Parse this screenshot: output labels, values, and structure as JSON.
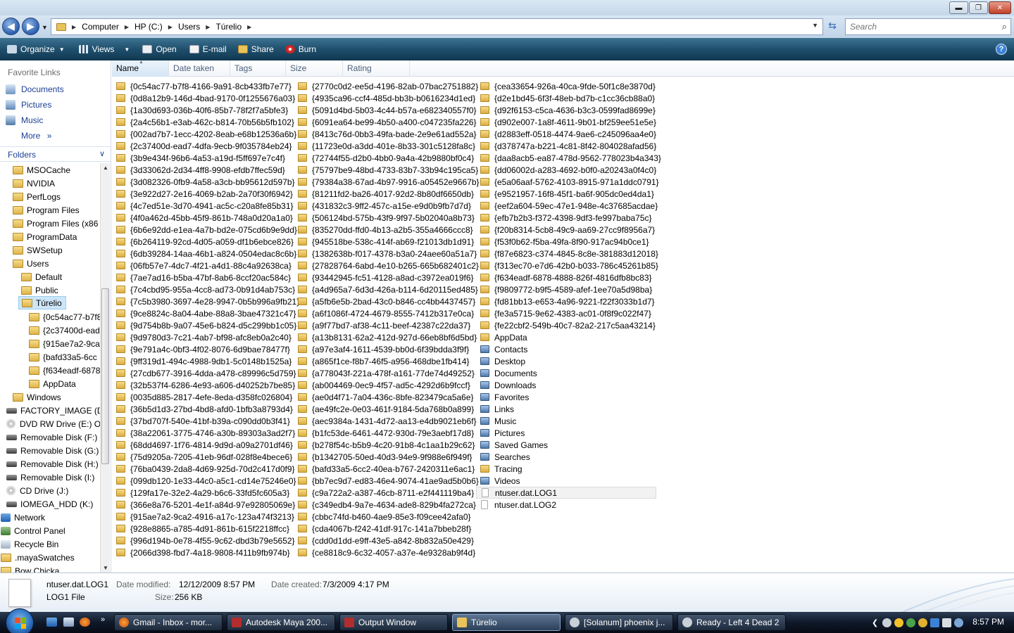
{
  "address": {
    "crumbs": [
      "Computer",
      "HP (C:)",
      "Users",
      "Túrelio"
    ],
    "search_placeholder": "Search"
  },
  "toolbar": {
    "organize": "Organize",
    "views": "Views",
    "open": "Open",
    "email": "E-mail",
    "share": "Share",
    "burn": "Burn"
  },
  "nav": {
    "favorite_links": "Favorite Links",
    "documents": "Documents",
    "pictures": "Pictures",
    "music": "Music",
    "more": "More",
    "folders": "Folders",
    "tree": [
      "MSOCache",
      "NVIDIA",
      "PerfLogs",
      "Program Files",
      "Program Files (x86",
      "ProgramData",
      "SWSetup",
      "Users",
      "Default",
      "Public",
      "Túrelio",
      "{0c54ac77-b7f8",
      "{2c37400d-ead",
      "{915ae7a2-9ca",
      "{bafd33a5-6cc",
      "{f634eadf-6878",
      "AppData",
      "Windows",
      "FACTORY_IMAGE (D",
      "DVD RW Drive (E:) O",
      "Removable Disk (F:)",
      "Removable Disk (G:)",
      "Removable Disk (H:)",
      "Removable Disk (I:)",
      "CD Drive (J:)",
      "IOMEGA_HDD (K:)",
      "Network",
      "Control Panel",
      "Recycle Bin",
      ".mayaSwatches",
      "Bow Chicka"
    ]
  },
  "columns": [
    "Name",
    "Date taken",
    "Tags",
    "Size",
    "Rating"
  ],
  "files": {
    "col1": [
      "{0c54ac77-b7f8-4166-9a91-8cb433fb7e77}",
      "{0d8a12b9-146d-4bad-9170-0f1255676a03}",
      "{1a30d693-036b-40f6-85b7-78f2f7a5bfe3}",
      "{2a4c56b1-e3ab-462c-b814-70b56b5fb102}",
      "{002ad7b7-1ecc-4202-8eab-e68b12536a6b}",
      "{2c37400d-ead7-4dfa-9ecb-9f035784eb24}",
      "{3b9e434f-96b6-4a53-a19d-f5ff697e7c4f}",
      "{3d33062d-2d34-4ff8-9908-efdb7ffec59d}",
      "{3d082326-0fb9-4a58-a3cb-bb95612d597b}",
      "{3e922d27-2e16-4069-b2ab-2a70f30f6942}",
      "{4c7ed51e-3d70-4941-ac5c-c20a8fe85b31}",
      "{4f0a462d-45bb-45f9-861b-748a0d20a1a0}",
      "{6b6e92dd-e1ea-4a7b-bd2e-075cd6b9e9dd}",
      "{6b264119-92cd-4d05-a059-df1b6ebce826}",
      "{6db39284-14aa-46b1-a824-0504edac8c6b}",
      "{06fb57e7-4dc7-4f21-a4d1-88c4a92638ca}",
      "{7ae7ad16-b5ba-47bf-8ab6-8ccf20ac584c}",
      "{7c4cbd95-955a-4cc8-ad73-0b91d4ab753c}",
      "{7c5b3980-3697-4e28-9947-0b5b996a9fb21}",
      "{9ce8824c-8a04-4abe-88a8-3bae47321c47}",
      "{9d754b8b-9a07-45e6-b824-d5c299bb1c05}",
      "{9d9780d3-7c21-4ab7-bf98-afc8eb0a2c40}",
      "{9e791a4c-0bf3-4f02-8076-6d9bae78477f}",
      "{9ff319d1-494c-4988-9db1-5c0148b1525a}",
      "{27cdb677-3916-4dda-a478-c89996c5d759}",
      "{32b537f4-6286-4e93-a606-d40252b7be85}",
      "{0035d885-2817-4efe-8eda-d358fc026804}",
      "{36b5d1d3-27bd-4bd8-afd0-1bfb3a8793d4}",
      "{37bd707f-540e-41bf-b39a-c090dd0b3f41}",
      "{38a22061-3775-4746-a30b-89303a3ad2f7}",
      "{68dd4697-1f76-4814-9d9d-a09a2701df46}",
      "{75d9205a-7205-41eb-96df-028f8e4bece6}",
      "{76ba0439-2da8-4d69-925d-70d2c417d0f9}",
      "{099db120-1e33-44c0-a5c1-cd14e75246e0}",
      "{129fa17e-32e2-4a29-b6c6-33fd5fc605a3}",
      "{366e8a76-5201-4e1f-a84d-97e92805069e}",
      "{915ae7a2-9ca2-4916-a17c-123a474f3213}",
      "{928e8865-a785-4d91-861b-615f2218ffcc}",
      "{996d194b-0e78-4f55-9c62-dbd3b79e5652}",
      "{2066d398-fbd7-4a18-9808-f411b9fb974b}"
    ],
    "col2": [
      "{2770c0d2-ee5d-4196-82ab-07bac2751882}",
      "{4935ca96-ccf4-485d-bb3b-b0616234d1ed}",
      "{5091d4bd-5b03-4c44-b57a-e682340557f0}",
      "{6091ea64-be99-4b50-a400-c047235fa226}",
      "{8413c76d-0bb3-49fa-bade-2e9e61ad552a}",
      "{11723e0d-a3dd-401e-8b33-301c5128fa8c}",
      "{72744f55-d2b0-4bb0-9a4a-42b9880bf0c4}",
      "{75797be9-48bd-4733-83b7-33b94c195ca5}",
      "{79384a38-67ad-4b97-9916-a05452e9667b}",
      "{81211fd2-ba26-4017-92d2-8b80df6650db}",
      "{431832c3-9ff2-457c-a15e-e9d0b9fb7d7d}",
      "{506124bd-575b-43f9-9f97-5b02040a8b73}",
      "{835270dd-ffd0-4b13-a2b5-355a4666ccc8}",
      "{945518be-538c-414f-ab69-f21013db1d91}",
      "{1382638b-f017-4378-b3a0-24aee60a51a7}",
      "{27828764-6abd-4e10-b265-665b682401c2}",
      "{93442945-fc51-4128-a8ad-c3972ea019f6}",
      "{a4d965a7-6d3d-426a-b114-6d20115ed485}",
      "{a5fb6e5b-2bad-43c0-b846-cc4bb4437457}",
      "{a6f1086f-4724-4679-8555-7412b317e0ca}",
      "{a9f77bd7-af38-4c11-beef-42387c22da37}",
      "{a13b8131-62a2-412d-927d-66eb8bf6d5bd}",
      "{a97e3af4-1611-4539-bb0d-6f39bdda3f9f}",
      "{a865f1ce-f8b7-46f5-a956-468dbe1fb414}",
      "{a778043f-221a-478f-a161-77de74d49252}",
      "{ab004469-0ec9-4f57-ad5c-4292d6b9fccf}",
      "{ae0d4f71-7a04-436c-8bfe-823479ca5a6e}",
      "{ae49fc2e-0e03-461f-9184-5da768b0a899}",
      "{aec9384a-1431-4d72-aa13-e4db9021eb6f}",
      "{b1fc53de-6461-4472-930d-79e3aebf17d8}",
      "{b278f54c-b5b9-4c20-91b8-4c1aa1b29c62}",
      "{b1342705-50ed-40d3-94e9-9f988e6f949f}",
      "{bafd33a5-6cc2-40ea-b767-2420311e6ac1}",
      "{bb7ec9d7-ed83-46e4-9074-41ae9ad5b0b6}",
      "{c9a722a2-a387-46cb-8711-e2f441119ba4}",
      "{c349edb4-9a7e-4634-ade8-829b4fa272ca}",
      "{cbbc74fd-b460-4ae9-85e3-f09cee42afa0}",
      "{cda4067b-f242-41df-917c-141a7bbeb28f}",
      "{cdd0d1dd-e9ff-43e5-a842-8b832a50e429}",
      "{ce8818c9-6c32-4057-a37e-4e9328ab9f4d}"
    ],
    "col3": [
      "{cea33654-926a-40ca-9fde-50f1c8e3870d}",
      "{d2e1bd45-6f3f-48eb-bd7b-c1cc36cb88a0}",
      "{d92f6153-c5ca-4636-b3c3-0599fad8699e}",
      "{d902e007-1a8f-4611-9b01-bf259ee51e5e}",
      "{d2883eff-0518-4474-9ae6-c245096aa4e0}",
      "{d378747a-b221-4c81-8f42-804028afad56}",
      "{daa8acb5-ea87-478d-9562-778023b4a343}",
      "{dd06002d-a283-4692-b0f0-a20243a0f4c0}",
      "{e5a06aaf-5762-4103-8915-971a1ddc0791}",
      "{e9521957-16f8-45f1-ba6f-905dc0ed4da1}",
      "{eef2a604-59ec-47e1-948e-4c37685acdae}",
      "{efb7b2b3-f372-4398-9df3-fe997baba75c}",
      "{f20b8314-5cb8-49c9-aa69-27cc9f8956a7}",
      "{f53f0b62-f5ba-49fa-8f90-917ac94b0ce1}",
      "{f87e6823-c374-4845-8c8e-381883d12018}",
      "{f313ec70-e7d6-42b0-b033-786c45261b85}",
      "{f634eadf-6878-4888-826f-4816dfb8bc83}",
      "{f9809772-b9f5-4589-afef-1ee70a5d98ba}",
      "{fd81bb13-e653-4a96-9221-f22f3033b1d7}",
      "{fe3a5715-9e62-4383-ac01-0f8f9c022f47}",
      "{fe22cbf2-549b-40c7-82a2-217c5aa43214}",
      "AppData",
      "Contacts",
      "Desktop",
      "Documents",
      "Downloads",
      "Favorites",
      "Links",
      "Music",
      "Pictures",
      "Saved Games",
      "Searches",
      "Tracing",
      "Videos",
      "ntuser.dat.LOG1",
      "ntuser.dat.LOG2"
    ]
  },
  "details": {
    "name": "ntuser.dat.LOG1",
    "type": "LOG1 File",
    "date_modified_label": "Date modified:",
    "date_modified": "12/12/2009 8:57 PM",
    "date_created_label": "Date created:",
    "date_created": "7/3/2009 4:17 PM",
    "size_label": "Size:",
    "size": "256 KB"
  },
  "taskbar": {
    "tasks": [
      "Gmail - Inbox - mor...",
      "Autodesk Maya 200...",
      "Output Window",
      "Túrelio",
      "[Solanum] phoenix j...",
      "Ready - Left 4 Dead 2"
    ],
    "clock": "8:57 PM"
  }
}
